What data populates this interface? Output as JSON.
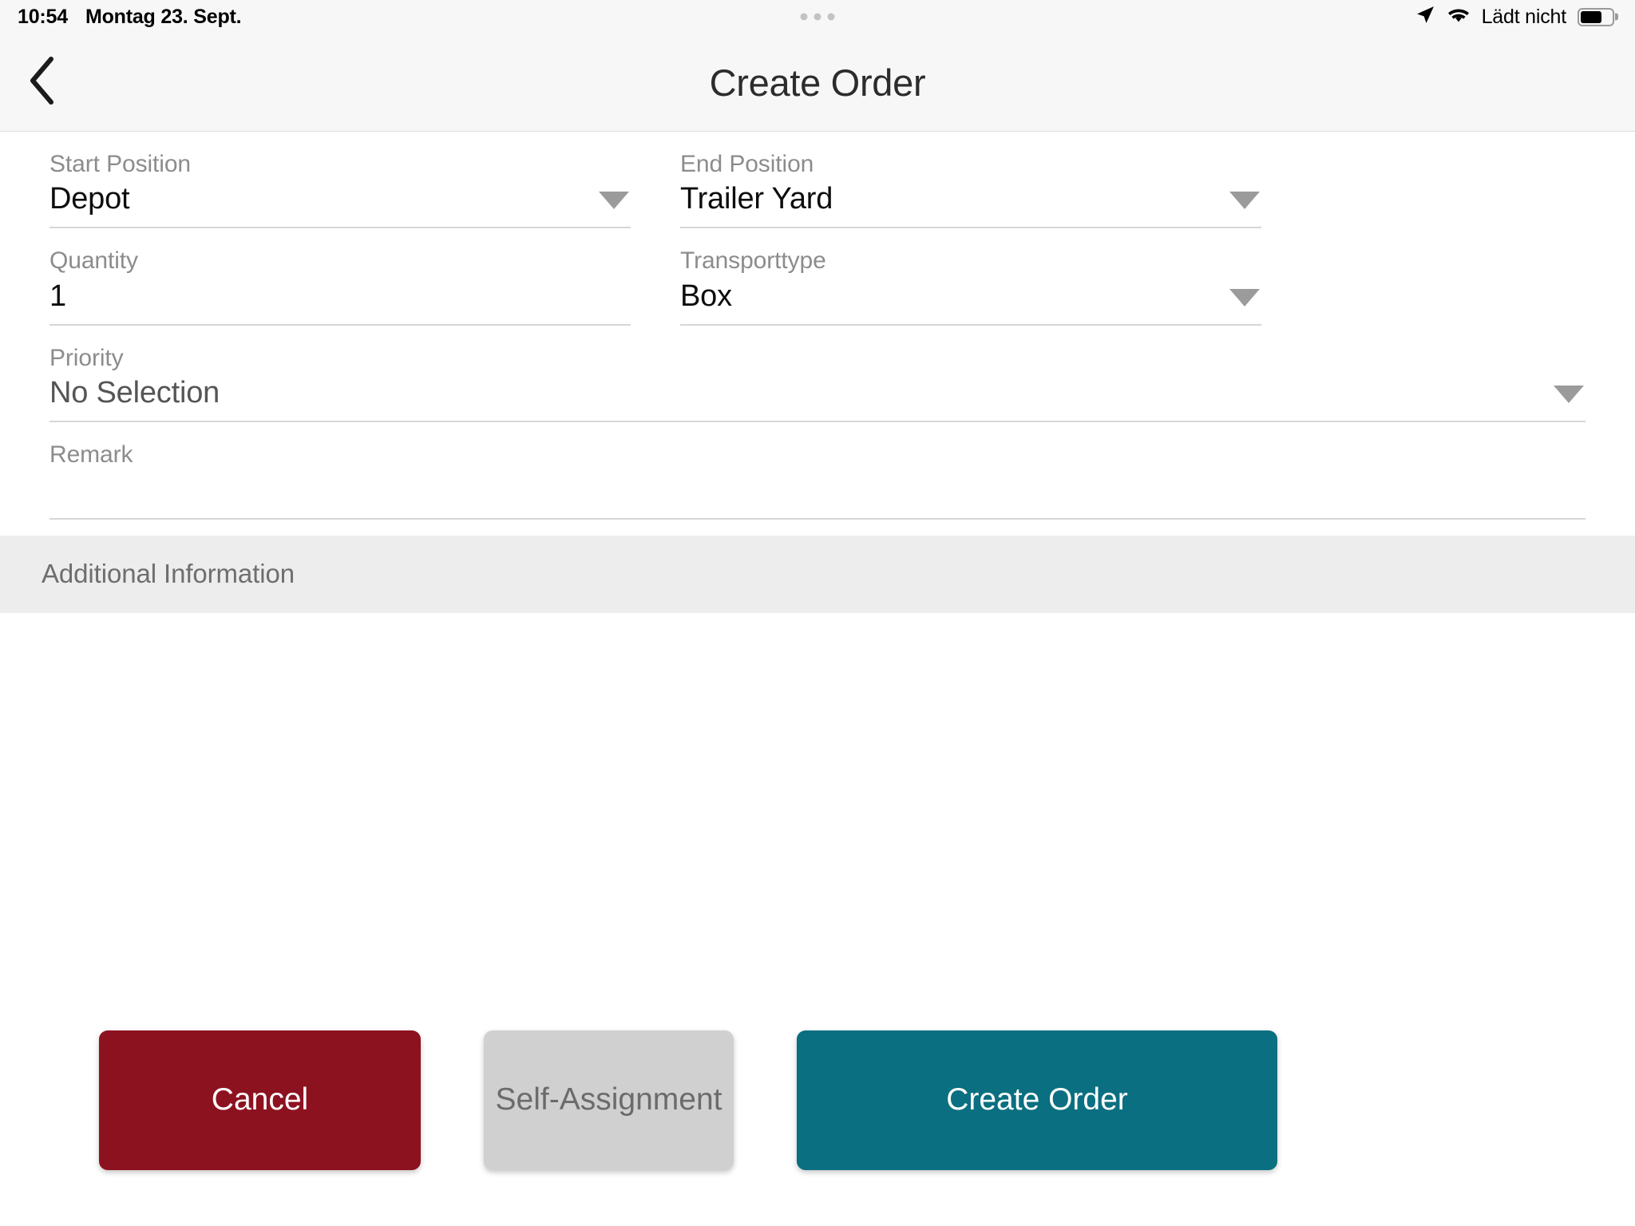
{
  "status_bar": {
    "time": "10:54",
    "date": "Montag 23. Sept.",
    "charging_text": "Lädt nicht",
    "battery_percent": 68,
    "icons": [
      "location-arrow-icon",
      "wifi-icon",
      "battery-icon"
    ]
  },
  "header": {
    "back_icon": "chevron-left-icon",
    "title": "Create Order"
  },
  "form": {
    "fields": [
      {
        "name": "start-position",
        "label": "Start Position",
        "value": "Depot",
        "type": "dropdown",
        "column": "left"
      },
      {
        "name": "end-position",
        "label": "End Position",
        "value": "Trailer Yard",
        "type": "dropdown",
        "column": "right"
      },
      {
        "name": "quantity",
        "label": "Quantity",
        "value": "1",
        "type": "text",
        "column": "left"
      },
      {
        "name": "transporttype",
        "label": "Transporttype",
        "value": "Box",
        "type": "dropdown",
        "column": "right"
      },
      {
        "name": "priority",
        "label": "Priority",
        "value": "No Selection",
        "type": "dropdown",
        "column": "full"
      },
      {
        "name": "remark",
        "label": "Remark",
        "value": "",
        "type": "text",
        "column": "full"
      }
    ]
  },
  "section": {
    "additional_information_label": "Additional Information"
  },
  "footer": {
    "cancel_label": "Cancel",
    "self_assignment_label": "Self-Assignment",
    "create_order_label": "Create Order"
  },
  "colors": {
    "cancel_bg": "#8d1220",
    "self_assignment_bg": "#d0d0d0",
    "create_order_bg": "#0a6f80",
    "section_bg": "#ededed",
    "chrome_bg": "#f7f7f7",
    "label_gray": "#8c8c8c",
    "underline_gray": "#d6d6d6"
  }
}
